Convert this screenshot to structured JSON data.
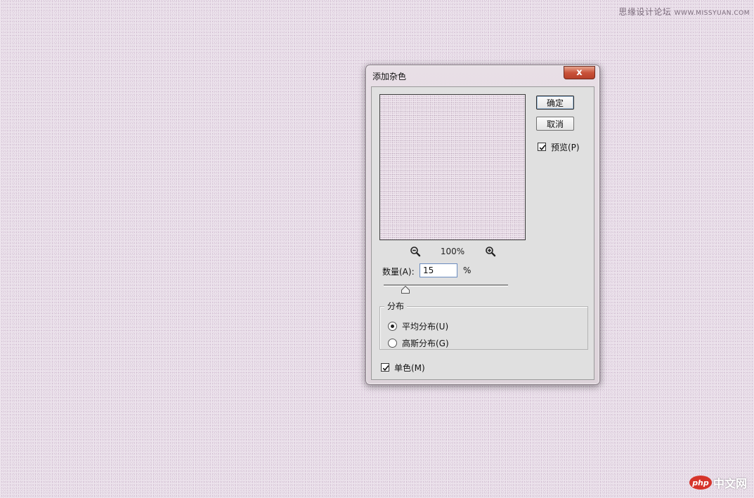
{
  "watermark": {
    "top_text": "思缘设计论坛",
    "top_site": "WWW.MISSYUAN.COM",
    "bottom_logo": "php",
    "bottom_text": "中文网"
  },
  "dialog": {
    "title": "添加杂色",
    "close_label": "x",
    "buttons": {
      "ok": "确定",
      "cancel": "取消"
    },
    "preview_checkbox": {
      "label": "预览(P)",
      "checked": true
    },
    "zoom": {
      "level": "100%",
      "zoom_out_icon": "zoom-out-icon",
      "zoom_in_icon": "zoom-in-icon"
    },
    "amount": {
      "label": "数量(A):",
      "value": "15",
      "unit": "%",
      "slider_fraction": 0.15
    },
    "distribution": {
      "group_title": "分布",
      "options": [
        {
          "label": "平均分布(U)",
          "selected": true
        },
        {
          "label": "高斯分布(G)",
          "selected": false
        }
      ]
    },
    "monochrome_checkbox": {
      "label": "单色(M)",
      "checked": true
    }
  }
}
